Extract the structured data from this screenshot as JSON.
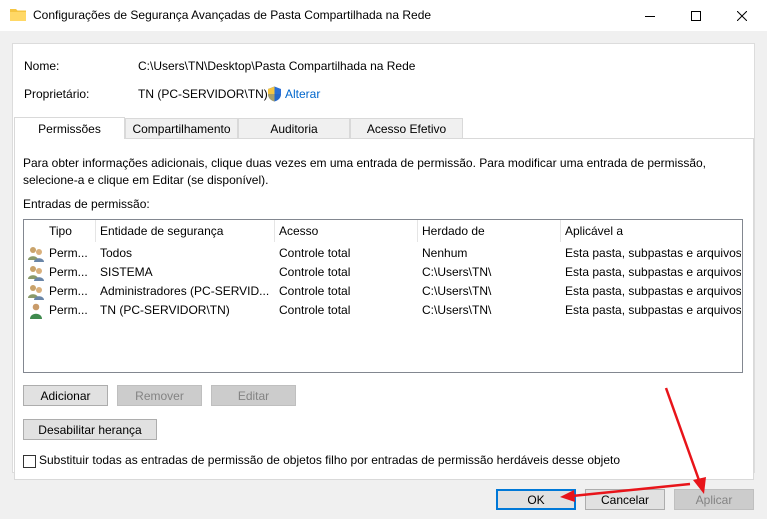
{
  "window": {
    "title": "Configurações de Segurança Avançadas de Pasta Compartilhada na Rede"
  },
  "info": {
    "name_label": "Nome:",
    "name_value": "C:\\Users\\TN\\Desktop\\Pasta Compartilhada na Rede",
    "owner_label": "Proprietário:",
    "owner_value": "TN (PC-SERVIDOR\\TN)",
    "change_link": "Alterar"
  },
  "tabs": [
    {
      "label": "Permissões",
      "active": true
    },
    {
      "label": "Compartilhamento",
      "active": false
    },
    {
      "label": "Auditoria",
      "active": false
    },
    {
      "label": "Acesso Efetivo",
      "active": false
    }
  ],
  "description": "Para obter informações adicionais, clique duas vezes em uma entrada de permissão. Para modificar uma entrada de permissão, selecione-a e clique em Editar (se disponível).",
  "entries_label": "Entradas de permissão:",
  "columns": [
    "Tipo",
    "Entidade de segurança",
    "Acesso",
    "Herdado de",
    "Aplicável a"
  ],
  "rows": [
    {
      "icon": "group-users-icon",
      "type": "Perm...",
      "principal": "Todos",
      "access": "Controle total",
      "inherited": "Nenhum",
      "applies": "Esta pasta, subpastas e arquivos"
    },
    {
      "icon": "group-users-icon",
      "type": "Perm...",
      "principal": "SISTEMA",
      "access": "Controle total",
      "inherited": "C:\\Users\\TN\\",
      "applies": "Esta pasta, subpastas e arquivos"
    },
    {
      "icon": "group-users-icon",
      "type": "Perm...",
      "principal": "Administradores (PC-SERVID...",
      "access": "Controle total",
      "inherited": "C:\\Users\\TN\\",
      "applies": "Esta pasta, subpastas e arquivos"
    },
    {
      "icon": "single-user-icon",
      "type": "Perm...",
      "principal": "TN (PC-SERVIDOR\\TN)",
      "access": "Controle total",
      "inherited": "C:\\Users\\TN\\",
      "applies": "Esta pasta, subpastas e arquivos"
    }
  ],
  "buttons": {
    "add": "Adicionar",
    "remove": "Remover",
    "edit": "Editar",
    "disable_inheritance": "Desabilitar herança",
    "ok": "OK",
    "cancel": "Cancelar",
    "apply": "Aplicar"
  },
  "replace_checkbox": {
    "label": "Substituir todas as entradas de permissão de objetos filho por entradas de permissão herdáveis desse objeto",
    "checked": false
  },
  "annotation_color": "#e8141a"
}
